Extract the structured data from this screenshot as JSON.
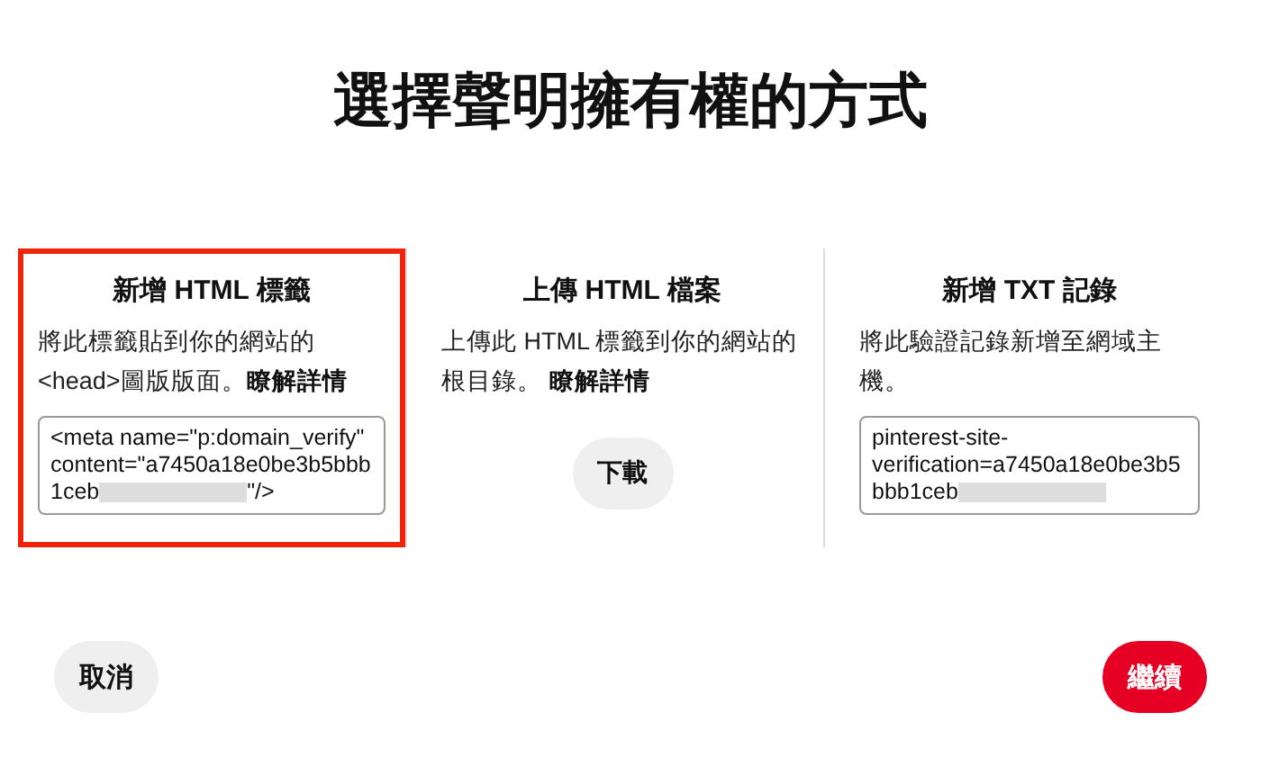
{
  "title": "選擇聲明擁有權的方式",
  "options": [
    {
      "kind": "code",
      "selected": true,
      "heading": "新增 HTML 標籤",
      "description": "將此標籤貼到你的網站的<head>圖版版面。",
      "link": "瞭解詳情",
      "code": "<meta name=\"p:domain_verify\" content=\"a7450a18e0be3b5bbb1ceb",
      "redacted": true,
      "code_end": "\"/>"
    },
    {
      "kind": "download",
      "selected": false,
      "heading": "上傳 HTML 檔案",
      "description": "上傳此 HTML 標籤到你的網站的根目錄。 ",
      "link": "瞭解詳情",
      "button": "下載"
    },
    {
      "kind": "code",
      "selected": false,
      "heading": "新增 TXT 記錄",
      "description": "將此驗證記錄新增至網域主機。",
      "code": "pinterest-site-verification=a7450a18e0be3b5bbb1ceb",
      "redacted": true
    }
  ],
  "buttons": [
    {
      "label": "取消",
      "primary": false
    },
    {
      "label": "繼續",
      "primary": true
    }
  ]
}
